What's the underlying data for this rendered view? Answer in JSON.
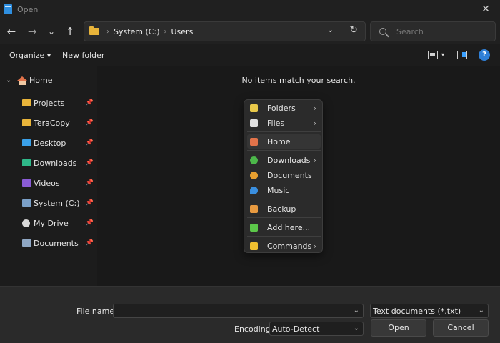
{
  "window": {
    "title": "Open",
    "icon": "notepad-icon",
    "close_icon": "✕"
  },
  "nav": {
    "back_icon": "←",
    "forward_icon": "→",
    "recent_icon": "⌄",
    "up_icon": "↑",
    "breadcrumb": [
      "System (C:)",
      "Users"
    ],
    "crumb_sep": "›",
    "dropdown_icon": "⌄",
    "refresh_icon": "↻",
    "search_placeholder": "Search"
  },
  "toolbar": {
    "organize_label": "Organize ▾",
    "new_folder_label": "New folder",
    "view_dropdown": "▾",
    "help_label": "?"
  },
  "sidebar": {
    "home": {
      "chevron": "⌄",
      "label": "Home"
    },
    "items": [
      {
        "label": "Projects",
        "icon": "folder-icon",
        "pinned": "📌"
      },
      {
        "label": "TeraCopy",
        "icon": "folder-icon",
        "pinned": "📌"
      },
      {
        "label": "Desktop",
        "icon": "desktop-icon",
        "pinned": "📌"
      },
      {
        "label": "Downloads",
        "icon": "downloads-icon",
        "pinned": "📌"
      },
      {
        "label": "Videos",
        "icon": "videos-icon",
        "pinned": "📌"
      },
      {
        "label": "System (C:)",
        "icon": "drive-icon",
        "pinned": "📌"
      },
      {
        "label": "My Drive",
        "icon": "google-drive-icon",
        "pinned": "📌"
      },
      {
        "label": "Documents",
        "icon": "documents-icon",
        "pinned": "📌"
      }
    ]
  },
  "main": {
    "empty_message": "No items match your search."
  },
  "context_menu": {
    "items": [
      {
        "label": "Folders",
        "icon": "folders-icon",
        "color": "#e8c84a",
        "arrow": "›"
      },
      {
        "label": "Files",
        "icon": "files-icon",
        "color": "#e0e0e0",
        "arrow": "›"
      },
      {
        "label": "Home",
        "icon": "home-icon",
        "color": "#e2734a",
        "arrow": ""
      },
      {
        "label": "Downloads",
        "icon": "downloads-icon",
        "color": "#4cb84a",
        "arrow": "›"
      },
      {
        "label": "Documents",
        "icon": "documents-icon",
        "color": "#e8a030",
        "arrow": ""
      },
      {
        "label": "Music",
        "icon": "music-icon",
        "color": "#3a8fe0",
        "arrow": ""
      },
      {
        "label": "Backup",
        "icon": "backup-icon",
        "color": "#e89a40",
        "arrow": ""
      },
      {
        "label": "Add here...",
        "icon": "add-icon",
        "color": "#5cc84a",
        "arrow": ""
      },
      {
        "label": "Commands",
        "icon": "lightning-icon",
        "color": "#f0c030",
        "arrow": "›"
      }
    ]
  },
  "footer": {
    "file_name_label": "File name:",
    "file_name_value": "",
    "file_type_value": "Text documents (*.txt)",
    "encoding_label": "Encoding:",
    "encoding_value": "Auto-Detect",
    "open_label": "Open",
    "cancel_label": "Cancel",
    "dropdown_icon": "⌄"
  }
}
